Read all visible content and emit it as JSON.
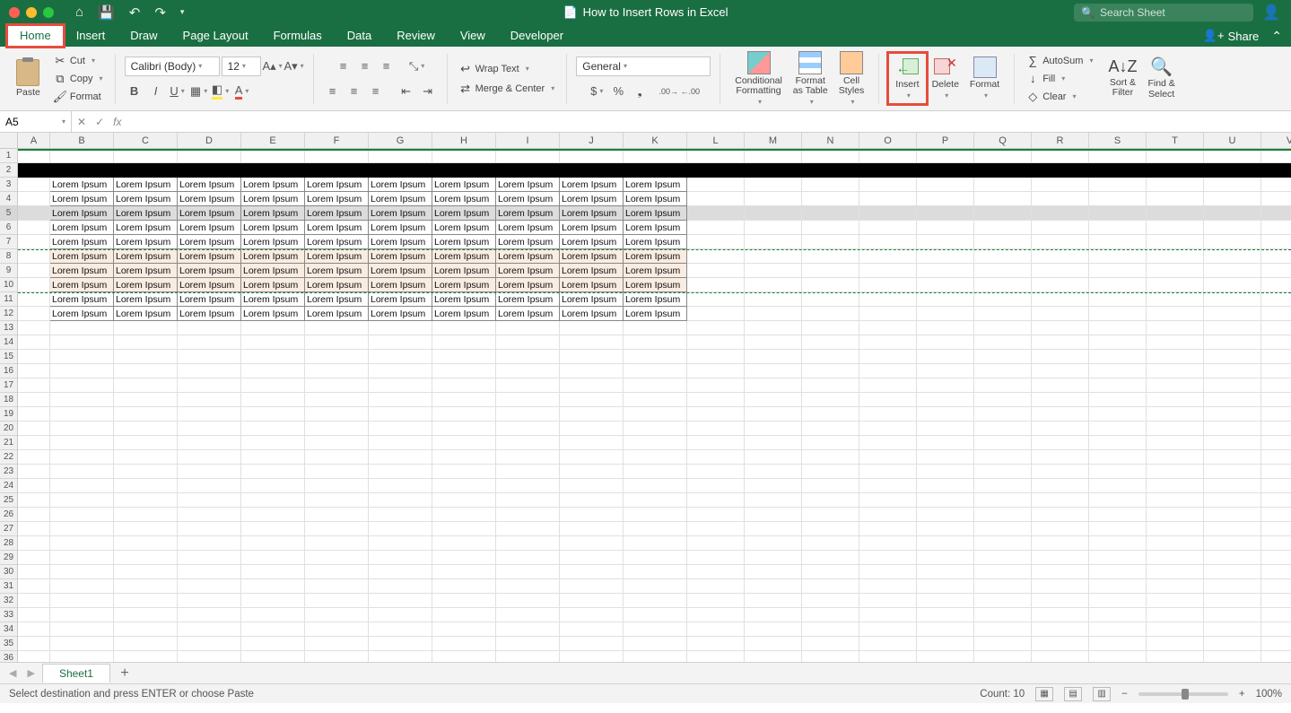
{
  "title": "How to Insert Rows in Excel",
  "search_placeholder": "Search Sheet",
  "share_label": "Share",
  "tabs": [
    "Home",
    "Insert",
    "Draw",
    "Page Layout",
    "Formulas",
    "Data",
    "Review",
    "View",
    "Developer"
  ],
  "active_tab": "Home",
  "clipboard": {
    "paste": "Paste",
    "cut": "Cut",
    "copy": "Copy",
    "format": "Format"
  },
  "font": {
    "name": "Calibri (Body)",
    "size": "12"
  },
  "alignment": {
    "wrap": "Wrap Text",
    "merge": "Merge & Center"
  },
  "number_format": "General",
  "cells_group": {
    "cond": "Conditional\nFormatting",
    "table": "Format\nas Table",
    "styles": "Cell\nStyles",
    "insert": "Insert",
    "delete": "Delete",
    "format": "Format"
  },
  "editing": {
    "autosum": "AutoSum",
    "fill": "Fill",
    "clear": "Clear",
    "sort": "Sort &\nFilter",
    "find": "Find &\nSelect"
  },
  "name_box": "A5",
  "columns": [
    "A",
    "B",
    "C",
    "D",
    "E",
    "F",
    "G",
    "H",
    "I",
    "J",
    "K",
    "L",
    "M",
    "N",
    "O",
    "P",
    "Q",
    "R",
    "S",
    "T",
    "U",
    "V"
  ],
  "first_col_width": 36,
  "data_col_width": 71,
  "empty_col_width": 64,
  "num_rows": 36,
  "selected_row": 5,
  "cut_rows": [
    8,
    9,
    10
  ],
  "data_rows": [
    3,
    4,
    5,
    6,
    7,
    8,
    9,
    10,
    11,
    12
  ],
  "header_row": 2,
  "data_cols": 10,
  "cell_text": "Lorem Ipsum",
  "sheet_name": "Sheet1",
  "status_msg": "Select destination and press ENTER or choose Paste",
  "status_count": "Count: 10",
  "zoom": "100%"
}
